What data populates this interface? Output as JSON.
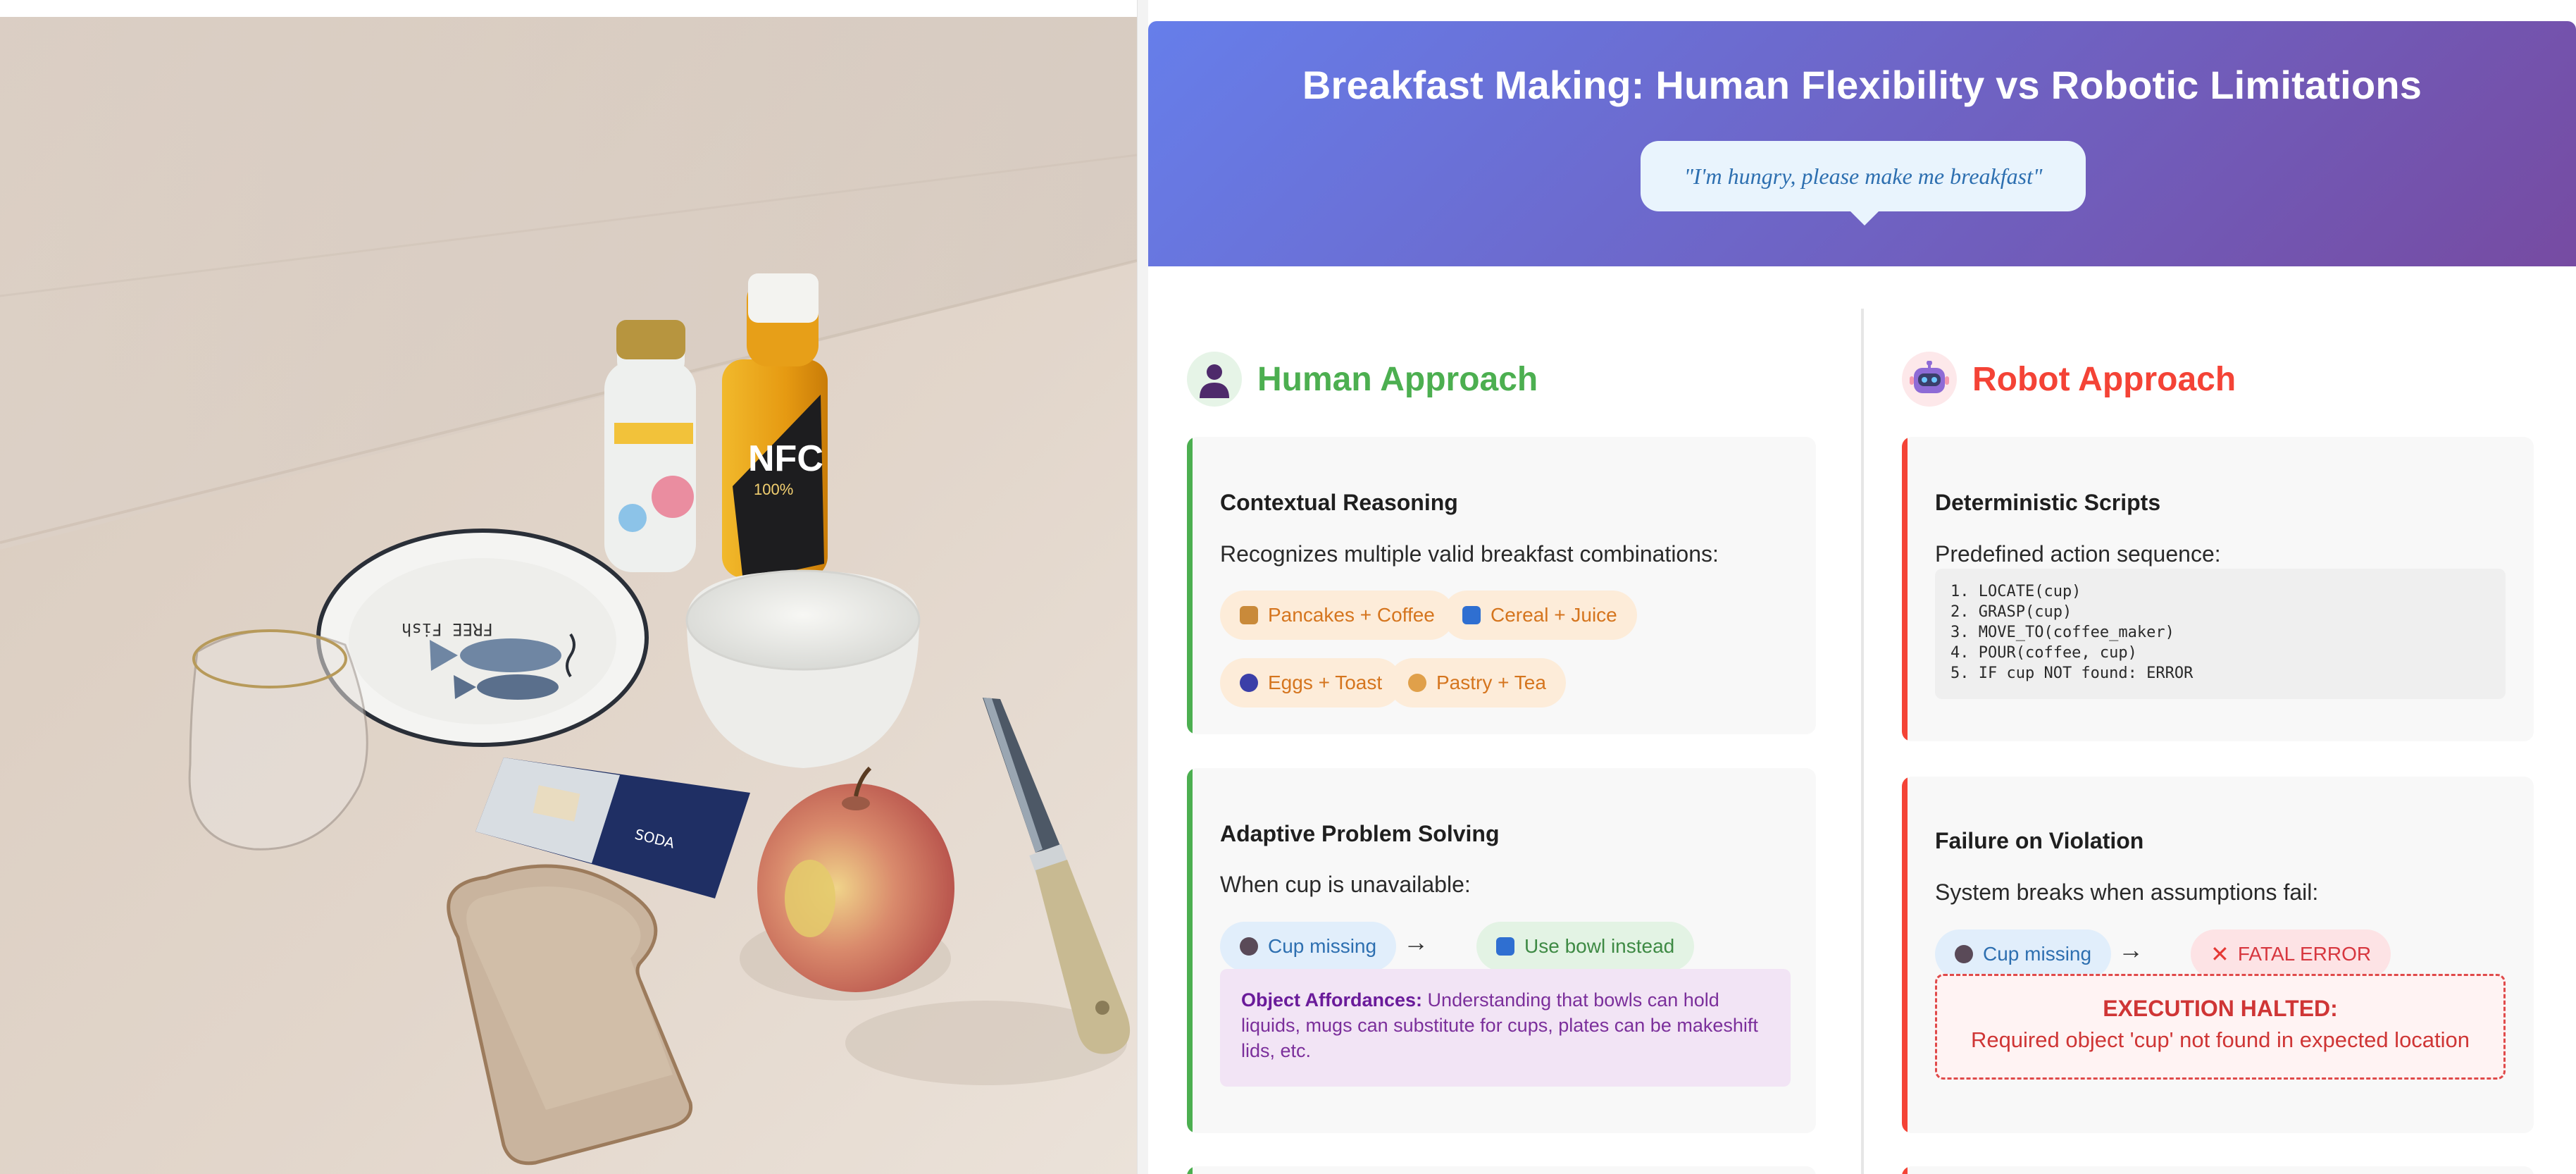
{
  "header": {
    "title": "Breakfast Making: Human Flexibility vs Robotic Limitations",
    "prompt": "\"I'm hungry, please make me breakfast\""
  },
  "human": {
    "title": "Human Approach",
    "avatar_icon": "person-icon",
    "accent": "#4caf50",
    "contextual": {
      "title": "Contextual Reasoning",
      "text": "Recognizes multiple valid breakfast combinations:",
      "chips": [
        {
          "label": "Pancakes + Coffee",
          "icon": "pancake-icon"
        },
        {
          "label": "Cereal + Juice",
          "icon": "cereal-icon"
        },
        {
          "label": "Eggs + Toast",
          "icon": "egg-icon"
        },
        {
          "label": "Pastry + Tea",
          "icon": "croissant-icon"
        }
      ]
    },
    "adaptive": {
      "title": "Adaptive Problem Solving",
      "text": "When cup is unavailable:",
      "from": "Cup missing",
      "to": "Use bowl instead",
      "arrow": "→",
      "note_label": "Object Affordances:",
      "note_text": " Understanding that bowls can hold liquids, mugs can substitute for cups, plates can be makeshift lids, etc."
    }
  },
  "robot": {
    "title": "Robot Approach",
    "avatar_icon": "robot-icon",
    "accent": "#f44336",
    "scripts": {
      "title": "Deterministic Scripts",
      "text": "Predefined action sequence:",
      "steps": [
        "1. LOCATE(cup)",
        "2. GRASP(cup)",
        "3. MOVE_TO(coffee_maker)",
        "4. POUR(coffee, cup)",
        "5. IF cup NOT found: ERROR"
      ]
    },
    "failure": {
      "title": "Failure on Violation",
      "text": "System breaks when assumptions fail:",
      "from": "Cup missing",
      "to": "FATAL ERROR",
      "arrow": "→",
      "halt_title": "EXECUTION HALTED:",
      "halt_msg": "Required object 'cup' not found in expected location"
    }
  },
  "colors": {
    "header_start": "#667eea",
    "header_end": "#764ba2",
    "human_accent": "#4caf50",
    "robot_accent": "#f44336"
  }
}
